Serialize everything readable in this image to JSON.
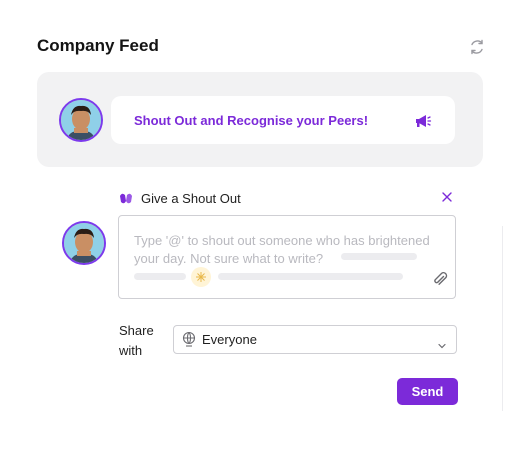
{
  "header": {
    "title": "Company Feed",
    "refresh_icon": "refresh-icon"
  },
  "banner": {
    "text": "Shout Out and Recognise your Peers!",
    "icon": "megaphone-icon"
  },
  "composer": {
    "section_label": "Give a Shout Out",
    "placeholder": "Type '@' to shout out someone who has brightened your day. Not sure what to write?",
    "attach_icon": "paperclip-icon",
    "close_icon": "close-icon"
  },
  "share": {
    "label": "Share with",
    "selected": "Everyone",
    "icon": "globe-icon"
  },
  "actions": {
    "send_label": "Send"
  },
  "colors": {
    "accent": "#7c2ad9",
    "banner_bg": "#f2f2f3",
    "border": "#cfcfd4"
  }
}
